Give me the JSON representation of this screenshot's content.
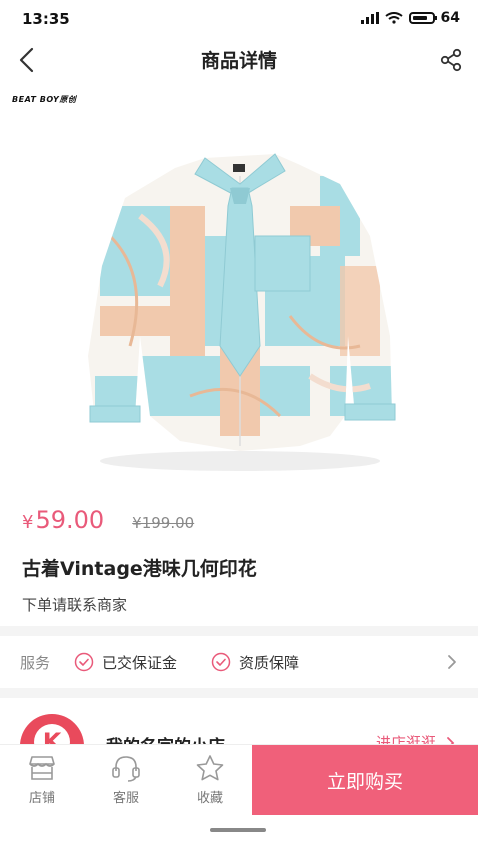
{
  "status_bar": {
    "time": "13:35",
    "battery": "64"
  },
  "nav": {
    "title": "商品详情",
    "back_icon": "back-chevron-icon",
    "share_icon": "share-icon"
  },
  "product": {
    "brand_tag": "BEAT BOY原创",
    "price_symbol": "¥",
    "price": "59.00",
    "original_price": "¥199.00",
    "title": "古着Vintage港味几何印花",
    "subtitle": "下单请联系商家"
  },
  "service": {
    "label": "服务",
    "items": [
      {
        "label": "已交保证金",
        "icon": "check-circle-icon"
      },
      {
        "label": "资质保障",
        "icon": "check-circle-icon"
      }
    ]
  },
  "shop": {
    "logo_letter": "K",
    "name": "我的名字的小店",
    "enter_label": "进店逛逛"
  },
  "bottom_bar": {
    "tabs": [
      {
        "label": "店铺",
        "icon": "store-icon"
      },
      {
        "label": "客服",
        "icon": "headset-icon"
      },
      {
        "label": "收藏",
        "icon": "star-icon"
      }
    ],
    "buy_label": "立即购买"
  },
  "colors": {
    "accent": "#f0607a",
    "price": "#e95a7a",
    "shirt_blue": "#a9dde4",
    "shirt_peach": "#f1c9ad"
  }
}
